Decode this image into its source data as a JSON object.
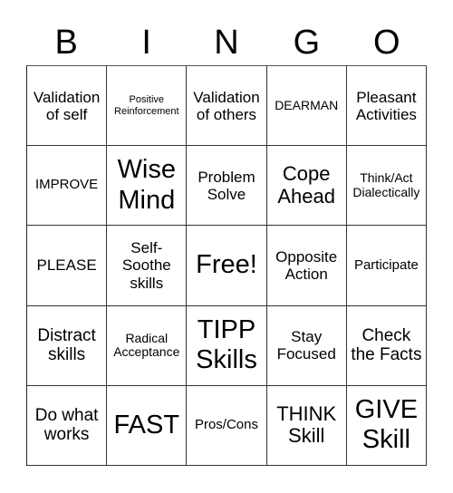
{
  "header": {
    "letters": [
      "B",
      "I",
      "N",
      "G",
      "O"
    ]
  },
  "cells": [
    {
      "text": "Validation of self",
      "size": "s-lg"
    },
    {
      "text": "Positive Reinforcement",
      "size": "s-xs"
    },
    {
      "text": "Validation of others",
      "size": "s-lg"
    },
    {
      "text": "DEARMAN",
      "size": "s-sm"
    },
    {
      "text": "Pleasant Activities",
      "size": "s-lg"
    },
    {
      "text": "IMPROVE",
      "size": "s-md"
    },
    {
      "text": "Wise Mind",
      "size": "s-big"
    },
    {
      "text": "Problem Solve",
      "size": "s-lg"
    },
    {
      "text": "Cope Ahead",
      "size": "s-xxl"
    },
    {
      "text": "Think/Act Dialectically",
      "size": "s-sm"
    },
    {
      "text": "PLEASE",
      "size": "s-lg"
    },
    {
      "text": "Self-Soothe skills",
      "size": "s-lg"
    },
    {
      "text": "Free!",
      "size": "s-big"
    },
    {
      "text": "Opposite Action",
      "size": "s-lg"
    },
    {
      "text": "Participate",
      "size": "s-md"
    },
    {
      "text": "Distract skills",
      "size": "s-xl"
    },
    {
      "text": "Radical Acceptance",
      "size": "s-sm"
    },
    {
      "text": "TIPP Skills",
      "size": "s-big"
    },
    {
      "text": "Stay Focused",
      "size": "s-lg"
    },
    {
      "text": "Check the Facts",
      "size": "s-xl"
    },
    {
      "text": "Do what works",
      "size": "s-xl"
    },
    {
      "text": "FAST",
      "size": "s-big"
    },
    {
      "text": "Pros/Cons",
      "size": "s-md"
    },
    {
      "text": "THINK Skill",
      "size": "s-xxl"
    },
    {
      "text": "GIVE Skill",
      "size": "s-big"
    }
  ]
}
